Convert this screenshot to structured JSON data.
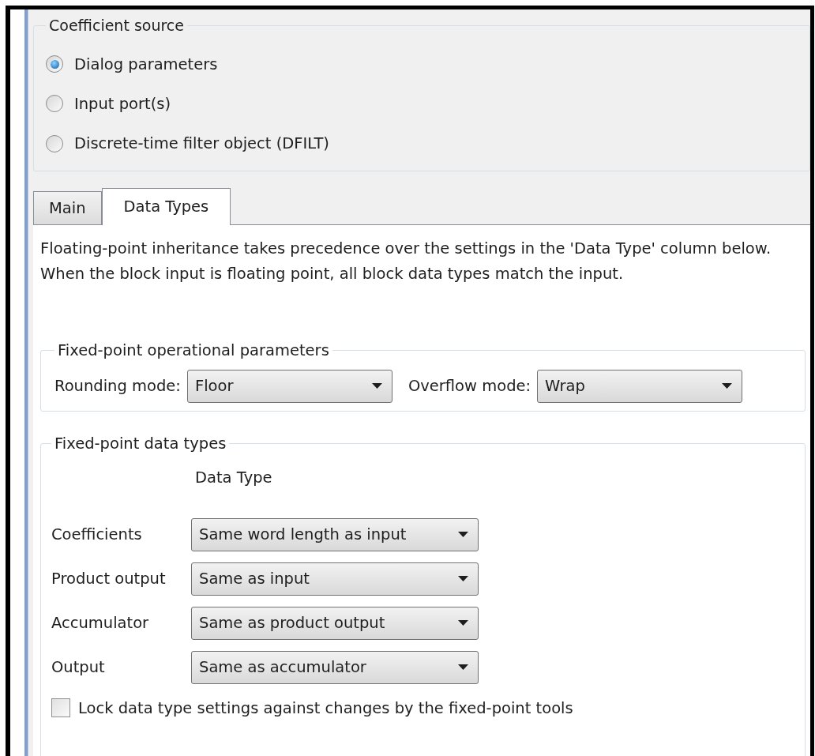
{
  "coefficient_source": {
    "title": "Coefficient source",
    "options": [
      {
        "label": "Dialog parameters",
        "selected": true
      },
      {
        "label": "Input port(s)",
        "selected": false
      },
      {
        "label": "Discrete-time filter object (DFILT)",
        "selected": false
      }
    ]
  },
  "tabs": [
    {
      "label": "Main",
      "selected": false
    },
    {
      "label": "Data Types",
      "selected": true
    }
  ],
  "description": "Floating-point inheritance takes precedence over the settings in the 'Data Type' column below. When the block input is floating point, all block data types match the input.",
  "operational_parameters": {
    "title": "Fixed-point operational parameters",
    "fields": [
      {
        "label": "Rounding mode:",
        "value": "Floor"
      },
      {
        "label": "Overflow mode:",
        "value": "Wrap"
      }
    ]
  },
  "data_types": {
    "title": "Fixed-point data types",
    "column_header": "Data Type",
    "rows": [
      {
        "label": "Coefficients",
        "value": "Same word length as input"
      },
      {
        "label": "Product output",
        "value": "Same as input"
      },
      {
        "label": "Accumulator",
        "value": "Same as product output"
      },
      {
        "label": "Output",
        "value": "Same as accumulator"
      }
    ],
    "lock": {
      "label": "Lock data type settings against changes by the fixed-point tools",
      "checked": false
    }
  }
}
